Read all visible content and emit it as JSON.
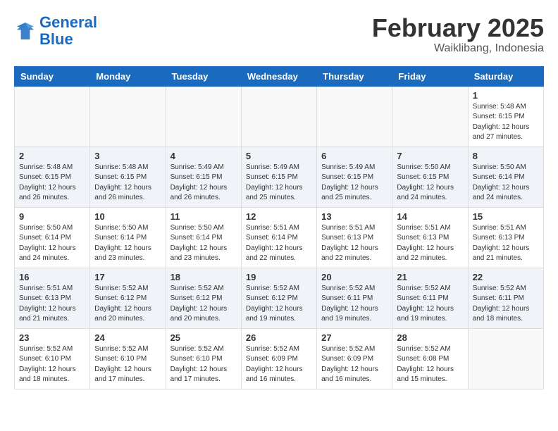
{
  "header": {
    "logo_line1": "General",
    "logo_line2": "Blue",
    "month": "February 2025",
    "location": "Waiklibang, Indonesia"
  },
  "weekdays": [
    "Sunday",
    "Monday",
    "Tuesday",
    "Wednesday",
    "Thursday",
    "Friday",
    "Saturday"
  ],
  "weeks": [
    [
      {
        "day": "",
        "info": ""
      },
      {
        "day": "",
        "info": ""
      },
      {
        "day": "",
        "info": ""
      },
      {
        "day": "",
        "info": ""
      },
      {
        "day": "",
        "info": ""
      },
      {
        "day": "",
        "info": ""
      },
      {
        "day": "1",
        "info": "Sunrise: 5:48 AM\nSunset: 6:15 PM\nDaylight: 12 hours\nand 27 minutes."
      }
    ],
    [
      {
        "day": "2",
        "info": "Sunrise: 5:48 AM\nSunset: 6:15 PM\nDaylight: 12 hours\nand 26 minutes."
      },
      {
        "day": "3",
        "info": "Sunrise: 5:48 AM\nSunset: 6:15 PM\nDaylight: 12 hours\nand 26 minutes."
      },
      {
        "day": "4",
        "info": "Sunrise: 5:49 AM\nSunset: 6:15 PM\nDaylight: 12 hours\nand 26 minutes."
      },
      {
        "day": "5",
        "info": "Sunrise: 5:49 AM\nSunset: 6:15 PM\nDaylight: 12 hours\nand 25 minutes."
      },
      {
        "day": "6",
        "info": "Sunrise: 5:49 AM\nSunset: 6:15 PM\nDaylight: 12 hours\nand 25 minutes."
      },
      {
        "day": "7",
        "info": "Sunrise: 5:50 AM\nSunset: 6:15 PM\nDaylight: 12 hours\nand 24 minutes."
      },
      {
        "day": "8",
        "info": "Sunrise: 5:50 AM\nSunset: 6:14 PM\nDaylight: 12 hours\nand 24 minutes."
      }
    ],
    [
      {
        "day": "9",
        "info": "Sunrise: 5:50 AM\nSunset: 6:14 PM\nDaylight: 12 hours\nand 24 minutes."
      },
      {
        "day": "10",
        "info": "Sunrise: 5:50 AM\nSunset: 6:14 PM\nDaylight: 12 hours\nand 23 minutes."
      },
      {
        "day": "11",
        "info": "Sunrise: 5:50 AM\nSunset: 6:14 PM\nDaylight: 12 hours\nand 23 minutes."
      },
      {
        "day": "12",
        "info": "Sunrise: 5:51 AM\nSunset: 6:14 PM\nDaylight: 12 hours\nand 22 minutes."
      },
      {
        "day": "13",
        "info": "Sunrise: 5:51 AM\nSunset: 6:13 PM\nDaylight: 12 hours\nand 22 minutes."
      },
      {
        "day": "14",
        "info": "Sunrise: 5:51 AM\nSunset: 6:13 PM\nDaylight: 12 hours\nand 22 minutes."
      },
      {
        "day": "15",
        "info": "Sunrise: 5:51 AM\nSunset: 6:13 PM\nDaylight: 12 hours\nand 21 minutes."
      }
    ],
    [
      {
        "day": "16",
        "info": "Sunrise: 5:51 AM\nSunset: 6:13 PM\nDaylight: 12 hours\nand 21 minutes."
      },
      {
        "day": "17",
        "info": "Sunrise: 5:52 AM\nSunset: 6:12 PM\nDaylight: 12 hours\nand 20 minutes."
      },
      {
        "day": "18",
        "info": "Sunrise: 5:52 AM\nSunset: 6:12 PM\nDaylight: 12 hours\nand 20 minutes."
      },
      {
        "day": "19",
        "info": "Sunrise: 5:52 AM\nSunset: 6:12 PM\nDaylight: 12 hours\nand 19 minutes."
      },
      {
        "day": "20",
        "info": "Sunrise: 5:52 AM\nSunset: 6:11 PM\nDaylight: 12 hours\nand 19 minutes."
      },
      {
        "day": "21",
        "info": "Sunrise: 5:52 AM\nSunset: 6:11 PM\nDaylight: 12 hours\nand 19 minutes."
      },
      {
        "day": "22",
        "info": "Sunrise: 5:52 AM\nSunset: 6:11 PM\nDaylight: 12 hours\nand 18 minutes."
      }
    ],
    [
      {
        "day": "23",
        "info": "Sunrise: 5:52 AM\nSunset: 6:10 PM\nDaylight: 12 hours\nand 18 minutes."
      },
      {
        "day": "24",
        "info": "Sunrise: 5:52 AM\nSunset: 6:10 PM\nDaylight: 12 hours\nand 17 minutes."
      },
      {
        "day": "25",
        "info": "Sunrise: 5:52 AM\nSunset: 6:10 PM\nDaylight: 12 hours\nand 17 minutes."
      },
      {
        "day": "26",
        "info": "Sunrise: 5:52 AM\nSunset: 6:09 PM\nDaylight: 12 hours\nand 16 minutes."
      },
      {
        "day": "27",
        "info": "Sunrise: 5:52 AM\nSunset: 6:09 PM\nDaylight: 12 hours\nand 16 minutes."
      },
      {
        "day": "28",
        "info": "Sunrise: 5:52 AM\nSunset: 6:08 PM\nDaylight: 12 hours\nand 15 minutes."
      },
      {
        "day": "",
        "info": ""
      }
    ]
  ]
}
